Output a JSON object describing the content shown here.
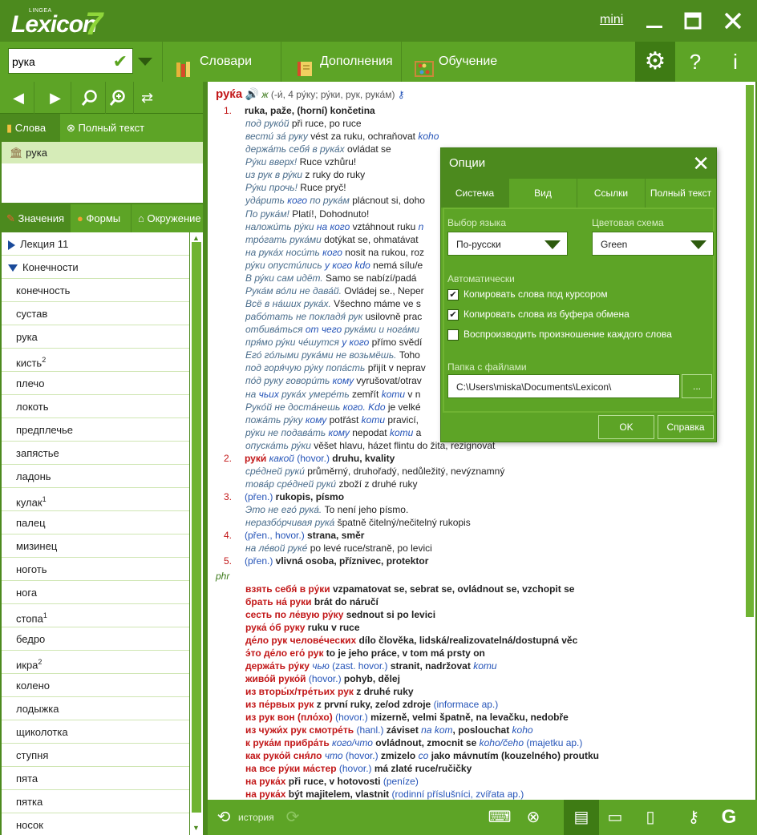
{
  "app": {
    "logo_small": "LINGEA",
    "logo_main": "Lexicon",
    "logo_num": "7",
    "mini_label": "mini"
  },
  "toolbar": {
    "search_value": "рука",
    "dictionaries_label": "Словари",
    "supplements_label": "Дополнения",
    "learning_label": "Обучение",
    "help_label": "?",
    "info_label": "i"
  },
  "left": {
    "words_tab": "Слова",
    "fulltext_tab": "Полный текст",
    "selected_word": "рука",
    "tabs": [
      "Значения",
      "Формы",
      "Окружение"
    ],
    "tree": [
      {
        "label": "Лекция 11",
        "type": "parent",
        "open": false,
        "sup": ""
      },
      {
        "label": "Конечности",
        "type": "parent",
        "open": true,
        "sup": ""
      },
      {
        "label": "конечность",
        "type": "child",
        "sup": ""
      },
      {
        "label": "сустав",
        "type": "child",
        "sup": ""
      },
      {
        "label": "рука",
        "type": "child",
        "sup": ""
      },
      {
        "label": "кисть",
        "type": "child",
        "sup": "2"
      },
      {
        "label": "плечо",
        "type": "child",
        "sup": ""
      },
      {
        "label": "локоть",
        "type": "child",
        "sup": ""
      },
      {
        "label": "предплечье",
        "type": "child",
        "sup": ""
      },
      {
        "label": "запястье",
        "type": "child",
        "sup": ""
      },
      {
        "label": "ладонь",
        "type": "child",
        "sup": ""
      },
      {
        "label": "кулак",
        "type": "child",
        "sup": "1"
      },
      {
        "label": "палец",
        "type": "child",
        "sup": ""
      },
      {
        "label": "мизинец",
        "type": "child",
        "sup": ""
      },
      {
        "label": "ноготь",
        "type": "child",
        "sup": ""
      },
      {
        "label": "нога",
        "type": "child",
        "sup": ""
      },
      {
        "label": "стопа",
        "type": "child",
        "sup": "1"
      },
      {
        "label": "бедро",
        "type": "child",
        "sup": ""
      },
      {
        "label": "икра",
        "type": "child",
        "sup": "2"
      },
      {
        "label": "колено",
        "type": "child",
        "sup": ""
      },
      {
        "label": "лодыжка",
        "type": "child",
        "sup": ""
      },
      {
        "label": "щиколотка",
        "type": "child",
        "sup": ""
      },
      {
        "label": "ступня",
        "type": "child",
        "sup": ""
      },
      {
        "label": "пята",
        "type": "child",
        "sup": ""
      },
      {
        "label": "пятка",
        "type": "child",
        "sup": ""
      },
      {
        "label": "носок",
        "type": "child",
        "sup": ""
      }
    ]
  },
  "entry": {
    "headword": "руќа",
    "gender": "ж",
    "grammar": "(-и́, 4 ру́ку; ру́ки, рук, рука́м)",
    "lines": [
      [
        [
          "num",
          "1."
        ],
        [
          "bd",
          "ruka, paže, (horní) končetina"
        ]
      ],
      [
        [
          "ex",
          "под руко́й"
        ],
        [
          "t",
          "  při ruce, po ruce"
        ]
      ],
      [
        [
          "ex",
          "вести́ за́ руку"
        ],
        [
          "t",
          "  vést za ruku, ochraňovat "
        ],
        [
          "bl",
          "koho"
        ]
      ],
      [
        [
          "ex",
          "держа́ть себя́ в рука́х"
        ],
        [
          "t",
          "  ovládat se"
        ]
      ],
      [
        [
          "ex",
          "Ру́ки вверх!"
        ],
        [
          "t",
          "  Ruce vzhůru!"
        ]
      ],
      [
        [
          "ex",
          "из рук в ру́ки"
        ],
        [
          "t",
          "  z ruky do ruky"
        ]
      ],
      [
        [
          "ex",
          "Ру́ки прочь!"
        ],
        [
          "t",
          "  Ruce pryč!"
        ]
      ],
      [
        [
          "ex",
          "уда́рить "
        ],
        [
          "bl",
          "кого"
        ],
        [
          "ex",
          " по рука́м"
        ],
        [
          "t",
          "  plácnout si, doho"
        ]
      ],
      [
        [
          "ex",
          "По рука́м!"
        ],
        [
          "t",
          "  Platí!, Dohodnuto!"
        ]
      ],
      [
        [
          "ex",
          "наложи́ть ру́ки "
        ],
        [
          "bl",
          "на кого"
        ],
        [
          "t",
          "  vztáhnout ruku "
        ],
        [
          "bl",
          "n"
        ]
      ],
      [
        [
          "ex",
          "тро́гать рука́ми"
        ],
        [
          "t",
          "  dotýkat se, ohmatávat"
        ]
      ],
      [
        [
          "ex",
          "на рука́х носи́ть "
        ],
        [
          "bl",
          "кого"
        ],
        [
          "t",
          "  nosit na rukou, roz"
        ]
      ],
      [
        [
          "ex",
          "ру́ки опусти́лись "
        ],
        [
          "bl",
          "у кого"
        ],
        [
          "t",
          "  "
        ],
        [
          "bl",
          "kdo"
        ],
        [
          "t",
          " nemá sílu/e"
        ]
      ],
      [
        [
          "ex",
          "В ру́ки сам идёт."
        ],
        [
          "t",
          "  Samo se nabízí/padá "
        ]
      ],
      [
        [
          "ex",
          "Рука́м во́ли не дава́й."
        ],
        [
          "t",
          "  Ovládej se., Neper"
        ]
      ],
      [
        [
          "ex",
          "Всё в на́ших рука́х."
        ],
        [
          "t",
          "  Všechno máme ve s"
        ]
      ],
      [
        [
          "ex",
          "рабо́тать не покладя́ рук"
        ],
        [
          "t",
          "  usilovně prac"
        ]
      ],
      [
        [
          "ex",
          "отбива́ться "
        ],
        [
          "bl",
          "от чего"
        ],
        [
          "ex",
          " рука́ми и нога́ми"
        ]
      ],
      [
        [
          "ex",
          "пря́мо ру́ки че́шутся "
        ],
        [
          "bl",
          "у кого"
        ],
        [
          "t",
          "  přímo svědí"
        ]
      ],
      [
        [
          "ex",
          "Его́ го́лыми рука́ми не возьмёшь."
        ],
        [
          "t",
          "  Toho"
        ]
      ],
      [
        [
          "ex",
          "под горя́чую ру́ку попа́сть"
        ],
        [
          "t",
          "  přijít v neprav"
        ]
      ],
      [
        [
          "ex",
          "по́д руку говори́ть "
        ],
        [
          "bl",
          "кому"
        ],
        [
          "t",
          "  vyrušovat/otrav"
        ]
      ],
      [
        [
          "ex",
          "на "
        ],
        [
          "bl",
          "чьих"
        ],
        [
          "ex",
          " рука́х умере́ть"
        ],
        [
          "t",
          "  zemřít "
        ],
        [
          "bl",
          "komu"
        ],
        [
          "t",
          " v n"
        ]
      ],
      [
        [
          "ex",
          "Руко́й не доста́нешь "
        ],
        [
          "bl",
          "кого."
        ],
        [
          "t",
          "  "
        ],
        [
          "bl",
          "Kdo"
        ],
        [
          "t",
          " je velké"
        ]
      ],
      [
        [
          "ex",
          "пожа́ть ру́ку "
        ],
        [
          "bl",
          "кому"
        ],
        [
          "t",
          "  potřást "
        ],
        [
          "bl",
          "komu"
        ],
        [
          "t",
          " pravicí, "
        ]
      ],
      [
        [
          "ex",
          "ру́ки не подава́ть "
        ],
        [
          "bl",
          "кому"
        ],
        [
          "t",
          "  nepodat "
        ],
        [
          "bl",
          "komu"
        ],
        [
          "t",
          " a"
        ]
      ],
      [
        [
          "ex",
          "опуска́ть ру́ки"
        ],
        [
          "t",
          "  věšet hlavu, házet flintu do žita, rezignovat"
        ]
      ],
      [
        [
          "num",
          "2."
        ],
        [
          "pr",
          "руки́ "
        ],
        [
          "bl",
          "какой"
        ],
        [
          "info",
          "  (hovor.)"
        ],
        [
          "bd",
          "  druhu, kvality"
        ]
      ],
      [
        [
          "ex",
          "сре́дней руки́"
        ],
        [
          "t",
          "  průměrný, druhořadý, nedůležitý, nevýznamný"
        ]
      ],
      [
        [
          "ex",
          "това́р сре́дней руки́"
        ],
        [
          "t",
          "  zboží z druhé ruky"
        ]
      ],
      [
        [
          "num",
          "3."
        ],
        [
          "info",
          "(přen.)"
        ],
        [
          "bd",
          "  rukopis, písmo"
        ]
      ],
      [
        [
          "ex",
          "Это не его́ рука́."
        ],
        [
          "t",
          "  To není jeho písmo."
        ]
      ],
      [
        [
          "ex",
          "неразбо́рчивая рука́"
        ],
        [
          "t",
          "  špatně čitelný/nečitelný rukopis"
        ]
      ],
      [
        [
          "num",
          "4."
        ],
        [
          "info",
          "(přen., hovor.)"
        ],
        [
          "bd",
          "  strana, směr"
        ]
      ],
      [
        [
          "ex",
          "на ле́вой руке́"
        ],
        [
          "t",
          "  po levé ruce/straně, po levici"
        ]
      ],
      [
        [
          "num",
          "5."
        ],
        [
          "info",
          "(přen.)"
        ],
        [
          "bd",
          "  vlivná osoba, příznivec, protektor"
        ]
      ]
    ],
    "phr_label": "phr",
    "phrases": [
      [
        [
          "pr",
          "взять себя́ в ру́ки"
        ],
        [
          "bd",
          "  vzpamatovat se, sebrat se, ovládnout se, vzchopit se"
        ]
      ],
      [
        [
          "pr",
          "брать на́ руки"
        ],
        [
          "bd",
          "  brát do náručí"
        ]
      ],
      [
        [
          "pr",
          "сесть по ле́вую ру́ку"
        ],
        [
          "bd",
          "  sednout si po levici"
        ]
      ],
      [
        [
          "pr",
          "рука́ о́б руку"
        ],
        [
          "bd",
          "  ruku v ruce"
        ]
      ],
      [
        [
          "pr",
          "де́ло рук челове́ческих"
        ],
        [
          "bd",
          "  dílo člověka, lidská/realizovatelná/dostupná věc"
        ]
      ],
      [
        [
          "pr",
          "э́то де́ло его́ рук"
        ],
        [
          "bd",
          "  to je jeho práce, v tom má prsty on"
        ]
      ],
      [
        [
          "pr",
          "держа́ть ру́ку "
        ],
        [
          "bl",
          "чью"
        ],
        [
          "info",
          "  (zast. hovor.)"
        ],
        [
          "bd",
          "  stranit, nadržovat "
        ],
        [
          "bl",
          "komu"
        ]
      ],
      [
        [
          "pr",
          "живо́й руко́й"
        ],
        [
          "info",
          "  (hovor.)"
        ],
        [
          "bd",
          "  pohyb, dělej"
        ]
      ],
      [
        [
          "pr",
          "из вторы́х/тре́тьих рук"
        ],
        [
          "bd",
          "  z druhé ruky"
        ]
      ],
      [
        [
          "pr",
          "из пе́рвых рук"
        ],
        [
          "bd",
          "  z první ruky, ze/od zdroje "
        ],
        [
          "info",
          "(informace ap.)"
        ]
      ],
      [
        [
          "pr",
          "из рук вон (пло́хо)"
        ],
        [
          "info",
          "  (hovor.)"
        ],
        [
          "bd",
          "  mizerně, velmi špatně, na levačku, nedobře"
        ]
      ],
      [
        [
          "pr",
          "из чужи́х рук смотре́ть"
        ],
        [
          "info",
          "  (hanl.)"
        ],
        [
          "bd",
          "  záviset "
        ],
        [
          "bl",
          "na kom"
        ],
        [
          "bd",
          ", poslouchat "
        ],
        [
          "bl",
          "koho"
        ]
      ],
      [
        [
          "pr",
          "к рука́м прибра́ть "
        ],
        [
          "bl",
          "кого/что"
        ],
        [
          "bd",
          "  ovládnout, zmocnit se "
        ],
        [
          "bl",
          "koho/čeho"
        ],
        [
          "info",
          " (majetku ap.)"
        ]
      ],
      [
        [
          "pr",
          "как руко́й сня́ло "
        ],
        [
          "bl",
          "что"
        ],
        [
          "info",
          "  (hovor.)"
        ],
        [
          "bd",
          "  zmizelo "
        ],
        [
          "bl",
          "co"
        ],
        [
          "bd",
          " jako mávnutím (kouzelného) proutku"
        ]
      ],
      [
        [
          "pr",
          "на все ру́ки ма́стер"
        ],
        [
          "info",
          "  (hovor.)"
        ],
        [
          "bd",
          "  má zlaté ruce/ručičky"
        ]
      ],
      [
        [
          "pr",
          "на рука́х"
        ],
        [
          "bd",
          "  při ruce, v hotovosti "
        ],
        [
          "info",
          "(peníze)"
        ]
      ],
      [
        [
          "pr",
          "на рука́х"
        ],
        [
          "bd",
          "  být majitelem, vlastnit "
        ],
        [
          "info",
          "(rodinní příslušníci, zvířata ap.)"
        ]
      ]
    ]
  },
  "bottom": {
    "history_label": "история"
  },
  "dialog": {
    "title": "Опции",
    "tabs": [
      "Система",
      "Вид",
      "Ссылки",
      "Полный текст"
    ],
    "lang_label": "Выбор языка",
    "lang_value": "По-русски",
    "color_label": "Цветовая схема",
    "color_value": "Green",
    "auto_label": "Автоматически",
    "checks": [
      {
        "label": "Копировать слова под курсором",
        "checked": true
      },
      {
        "label": "Копировать слова из буфера обмена",
        "checked": true
      },
      {
        "label": "Воспроизводить произношение каждого слова",
        "checked": false
      }
    ],
    "folder_label": "Папка с файлами",
    "folder_value": "C:\\Users\\miska\\Documents\\Lexicon\\",
    "browse_label": "...",
    "ok_label": "OK",
    "help_label": "Справка"
  },
  "colors": {
    "brand": "#5da426",
    "dark": "#4c8a1e",
    "accent_red": "#c21718",
    "link_blue": "#2554b8"
  }
}
